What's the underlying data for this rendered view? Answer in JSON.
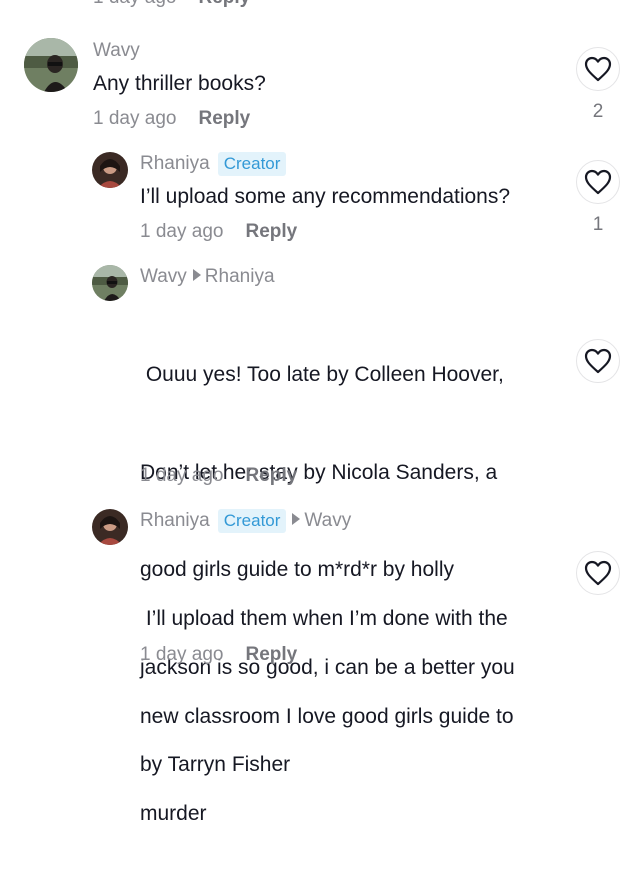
{
  "top_partial": {
    "time": "1 day ago",
    "reply_label": "Reply"
  },
  "comments": [
    {
      "username": "Wavy",
      "text": "Any thriller books?",
      "time": "1 day ago",
      "reply_label": "Reply",
      "like_count": "2",
      "avatar_icon": "avatar-wavy"
    },
    {
      "username": "Rhaniya",
      "badge": "Creator",
      "text": "I’ll upload some any recommendations?",
      "time": "1 day ago",
      "reply_label": "Reply",
      "like_count": "1",
      "avatar_icon": "avatar-rhaniya"
    },
    {
      "username": "Wavy",
      "reply_to": "Rhaniya",
      "text_lines": [
        " Ouuu yes! Too late by Colleen Hoover,",
        "Don’t let her stay by Nicola Sanders, a",
        "good girls guide to m*rd*r by holly",
        "jackson is so good, i can be a better you",
        "by Tarryn Fisher"
      ],
      "time": "1 day ago",
      "reply_label": "Reply",
      "avatar_icon": "avatar-wavy"
    },
    {
      "username": "Rhaniya",
      "badge": "Creator",
      "reply_to": "Wavy",
      "text_lines": [
        " I’ll upload them when I’m done with the",
        "new classroom I love good girls guide to",
        "murder"
      ],
      "time": "1 day ago",
      "reply_label": "Reply",
      "avatar_icon": "avatar-rhaniya"
    }
  ],
  "icons": {
    "like": "heart-outline-icon"
  },
  "colors": {
    "badge_bg": "#e3f3fb",
    "badge_text": "#3399d6",
    "muted": "#8a8b91"
  }
}
